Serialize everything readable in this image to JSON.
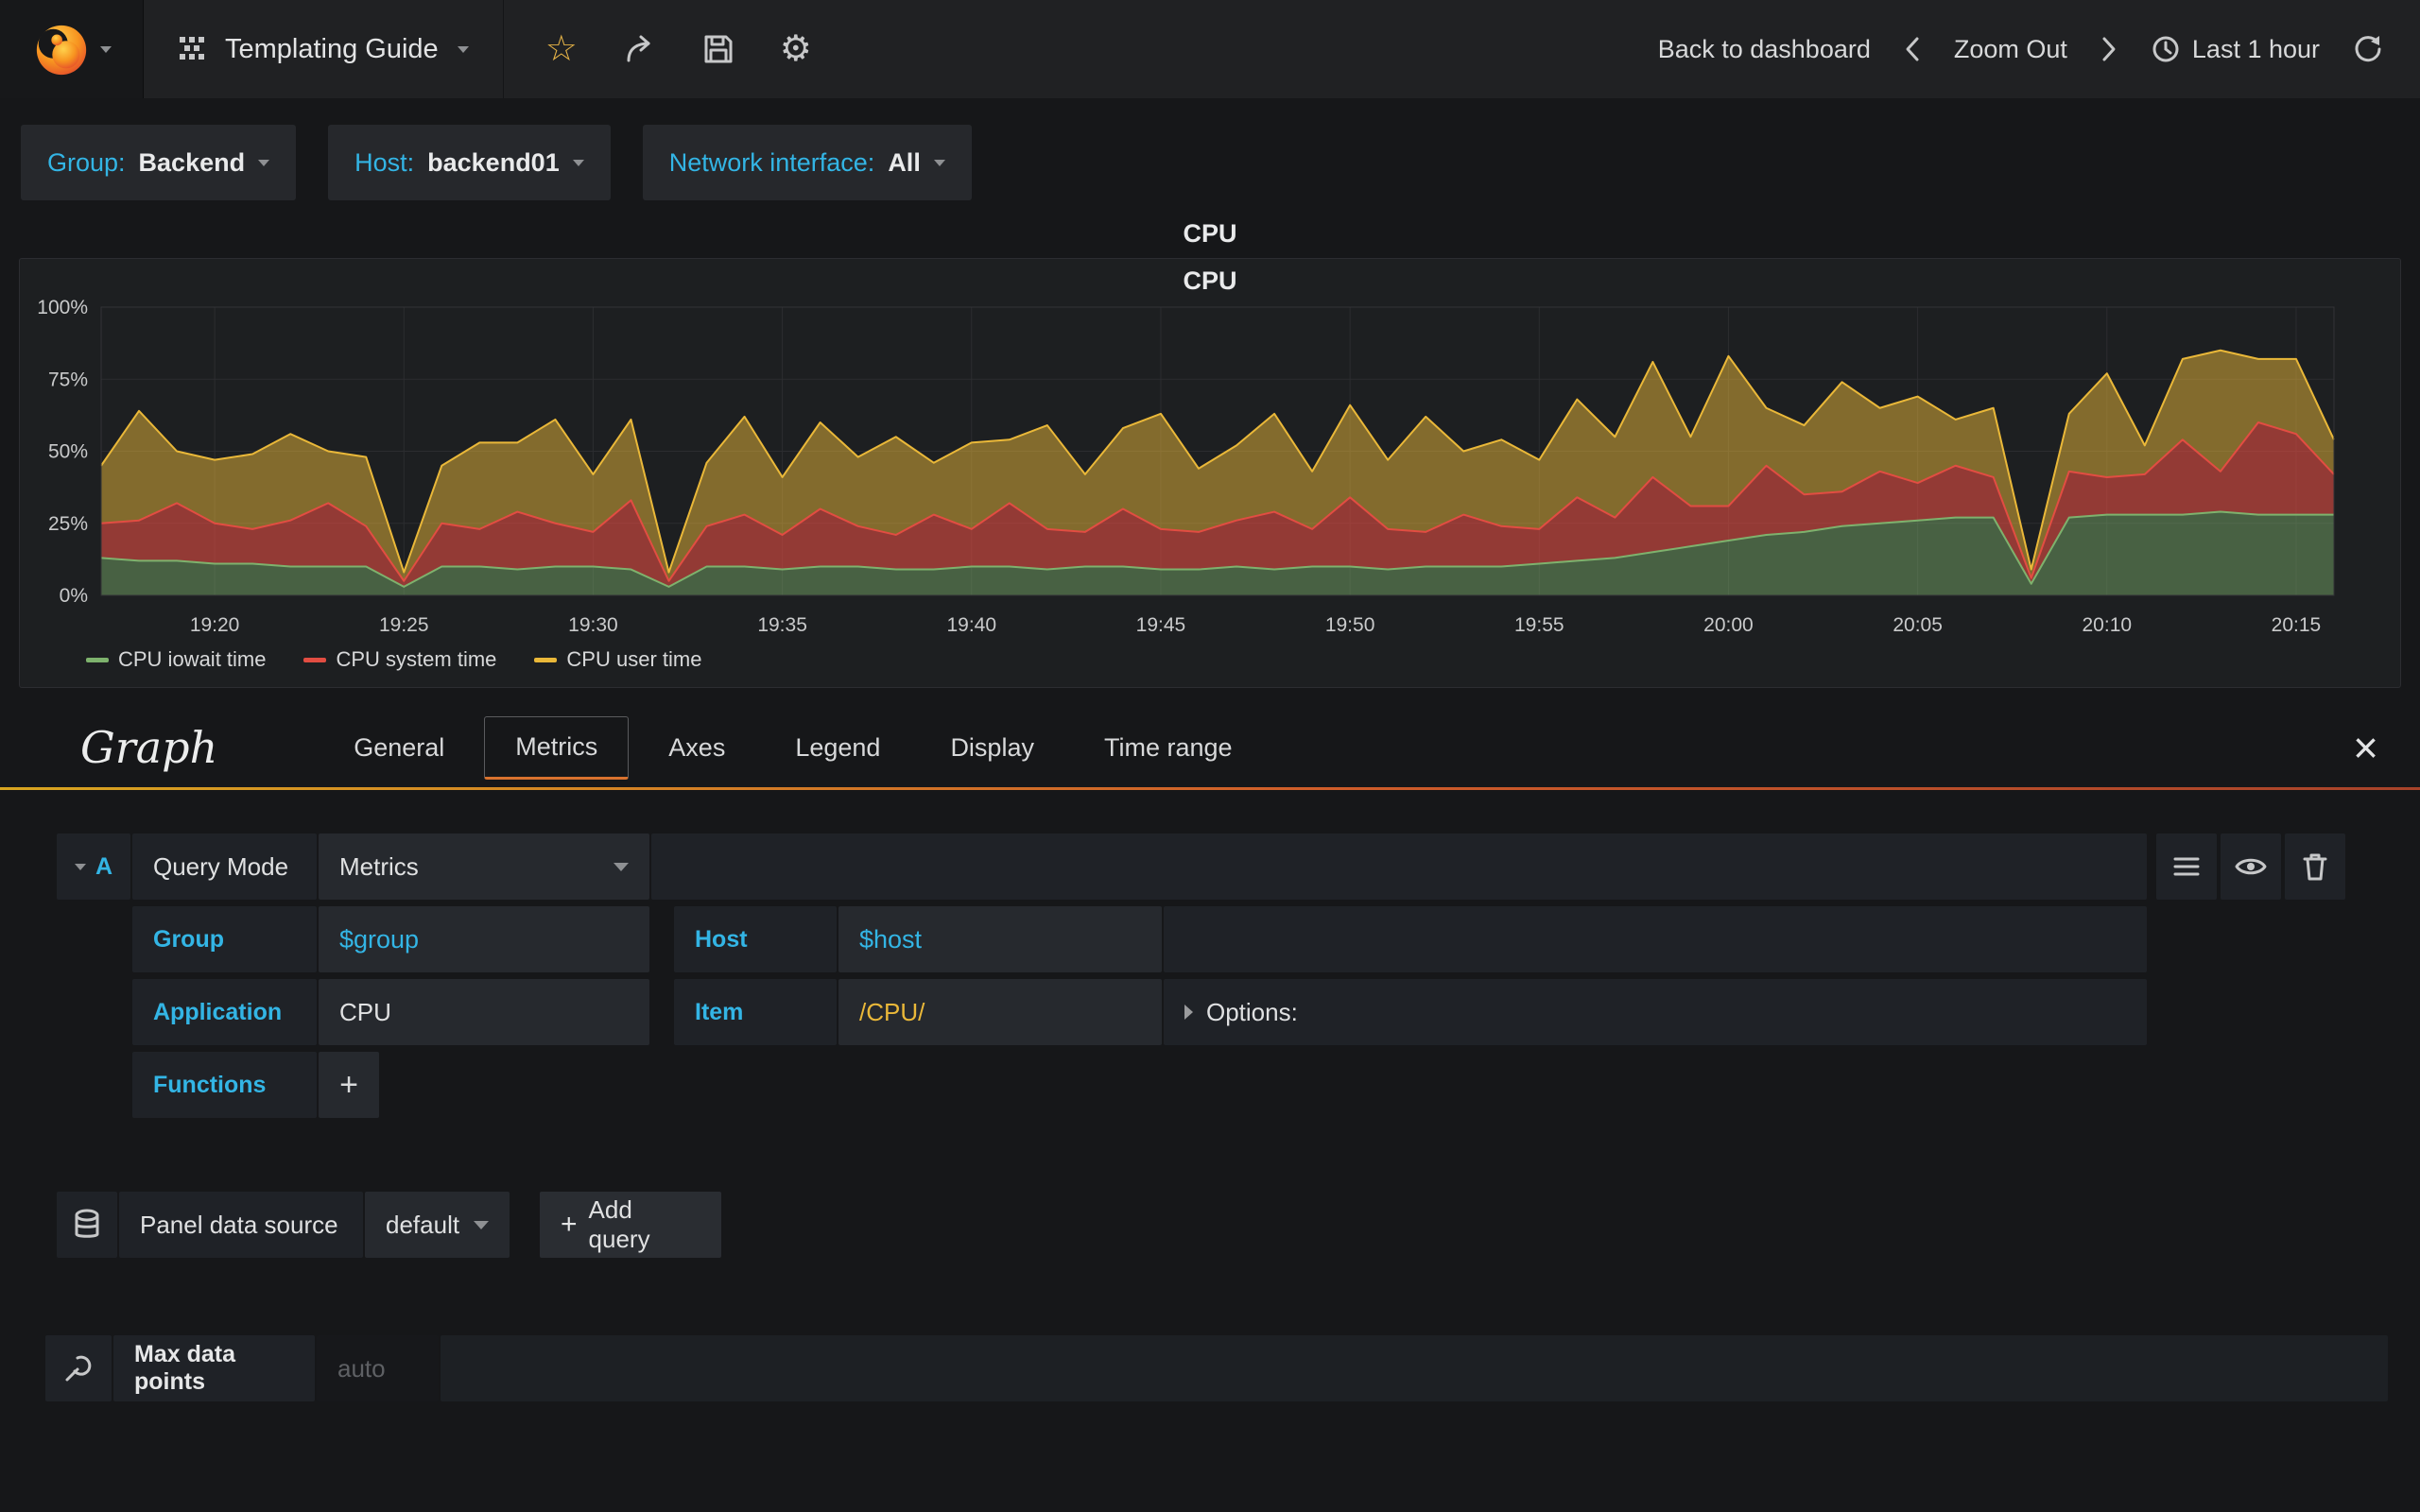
{
  "navbar": {
    "dashboard_title": "Templating Guide",
    "back_to_dashboard": "Back to dashboard",
    "zoom_out": "Zoom Out",
    "time_range": "Last 1 hour"
  },
  "variables": [
    {
      "label": "Group:",
      "value": "Backend"
    },
    {
      "label": "Host:",
      "value": "backend01"
    },
    {
      "label": "Network interface:",
      "value": "All"
    }
  ],
  "panel": {
    "title": "CPU",
    "graph_title": "CPU"
  },
  "chart_data": {
    "type": "area",
    "stacked": true,
    "title": "CPU",
    "ylim": [
      0,
      100
    ],
    "y_tick_values": [
      0,
      25,
      50,
      75,
      100
    ],
    "y_tick_labels": [
      "0%",
      "25%",
      "50%",
      "75%",
      "100%"
    ],
    "x_tick_labels": [
      "19:20",
      "19:25",
      "19:30",
      "19:35",
      "19:40",
      "19:45",
      "19:50",
      "19:55",
      "20:00",
      "20:05",
      "20:10",
      "20:15"
    ],
    "x_tick_indices": [
      3,
      8,
      13,
      18,
      23,
      28,
      33,
      38,
      43,
      48,
      53,
      58
    ],
    "time_start": "19:17",
    "time_end": "20:16",
    "legend_position": "bottom-left",
    "grid": true,
    "series": [
      {
        "name": "CPU iowait time",
        "color": "#7EB26D",
        "fill_opacity": 0.45,
        "values": [
          13,
          12,
          12,
          11,
          11,
          10,
          10,
          10,
          3,
          10,
          10,
          9,
          10,
          10,
          9,
          3,
          10,
          10,
          9,
          10,
          10,
          9,
          9,
          10,
          10,
          9,
          10,
          10,
          9,
          9,
          10,
          9,
          10,
          10,
          9,
          10,
          10,
          10,
          11,
          12,
          13,
          15,
          17,
          19,
          21,
          22,
          24,
          25,
          26,
          27,
          27,
          4,
          27,
          28,
          28,
          28,
          29,
          28,
          28,
          28
        ]
      },
      {
        "name": "CPU system time",
        "color": "#E24D42",
        "fill_opacity": 0.6,
        "values": [
          12,
          14,
          20,
          14,
          12,
          16,
          22,
          14,
          2,
          15,
          13,
          20,
          15,
          12,
          24,
          2,
          14,
          18,
          12,
          20,
          14,
          12,
          19,
          13,
          22,
          14,
          12,
          20,
          14,
          13,
          16,
          20,
          13,
          24,
          14,
          12,
          18,
          14,
          12,
          22,
          14,
          26,
          14,
          12,
          24,
          13,
          12,
          18,
          13,
          18,
          14,
          2,
          16,
          13,
          14,
          26,
          14,
          32,
          28,
          14
        ]
      },
      {
        "name": "CPU user time",
        "color": "#EAB839",
        "fill_opacity": 0.5,
        "values": [
          20,
          38,
          18,
          22,
          26,
          30,
          18,
          24,
          3,
          20,
          30,
          24,
          36,
          20,
          28,
          3,
          22,
          34,
          20,
          30,
          24,
          34,
          18,
          30,
          22,
          36,
          20,
          28,
          40,
          22,
          26,
          34,
          20,
          32,
          24,
          40,
          22,
          30,
          24,
          34,
          28,
          40,
          24,
          52,
          20,
          24,
          38,
          22,
          30,
          16,
          24,
          3,
          20,
          36,
          10,
          28,
          42,
          22,
          26,
          12
        ]
      }
    ]
  },
  "editor": {
    "panel_type": "Graph",
    "tabs": [
      "General",
      "Metrics",
      "Axes",
      "Legend",
      "Display",
      "Time range"
    ],
    "active_tab": "Metrics",
    "query": {
      "letter": "A",
      "mode_label": "Query Mode",
      "mode_value": "Metrics",
      "group_label": "Group",
      "group_value": "$group",
      "host_label": "Host",
      "host_value": "$host",
      "application_label": "Application",
      "application_value": "CPU",
      "item_label": "Item",
      "item_value": "/CPU/",
      "options_label": "Options:",
      "functions_label": "Functions",
      "add_function_label": "+"
    },
    "datasource": {
      "label": "Panel data source",
      "value": "default",
      "add_query_label": "Add query"
    },
    "max_data_points": {
      "label": "Max data points",
      "placeholder": "auto"
    }
  }
}
